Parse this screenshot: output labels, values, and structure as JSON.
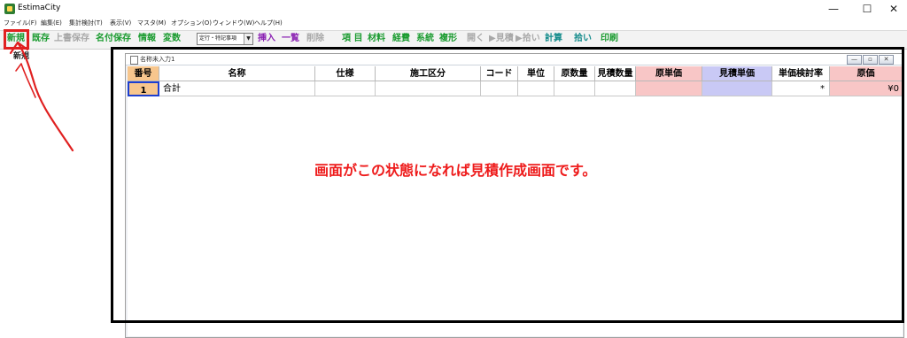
{
  "window": {
    "title": "EstimaCity",
    "controls": {
      "minimize": "—",
      "maximize": "☐",
      "close": "✕"
    }
  },
  "menu": [
    "ファイル(F)",
    "編集(E)",
    "集計検討(T)",
    "表示(V)",
    "マスタ(M)",
    "オプション(O)",
    "ウィンドウ(W)",
    "ヘルプ(H)"
  ],
  "toolbar": {
    "new": "新規",
    "existing": "既存",
    "overwrite_save": "上書保存",
    "save_as": "名付保存",
    "info": "情報",
    "variables": "変数",
    "combo_value": "定行・特記事項",
    "insert": "挿入",
    "list": "一覧",
    "delete": "削除",
    "item": "項 目",
    "material": "材料",
    "expense": "経費",
    "system": "系統",
    "composite": "複形",
    "open": "開く",
    "view_estimate": "▶見積",
    "pickup": "▶拾い",
    "calculate": "計算",
    "pickup2": "拾い",
    "print": "印刷"
  },
  "tree": {
    "root_label": "新規"
  },
  "child_window": {
    "title": "名称未入力1",
    "controls": {
      "minimize": "—",
      "restore": "▫",
      "close": "✕"
    }
  },
  "grid": {
    "columns": [
      "番号",
      "名称",
      "仕様",
      "施工区分",
      "コード",
      "単位",
      "原数量",
      "見積数量",
      "原単価",
      "見積単価",
      "単価検討率",
      "原価"
    ],
    "rows": [
      {
        "no": "1",
        "name": "合計",
        "spec": "",
        "division": "",
        "code": "",
        "unit": "",
        "orig_qty": "",
        "est_qty": "",
        "orig_unit_price": "",
        "est_unit_price": "",
        "rate": "*",
        "cost": "¥0"
      }
    ]
  },
  "annotation": {
    "text": "画面がこの状態になれば見積作成画面です。"
  },
  "colors": {
    "annotation_red": "#e02020",
    "header_orange": "#f7c68d",
    "pink_column": "#f8c6c6",
    "lavender_column": "#c9c9f5",
    "toolbar_green": "#1a9b2f"
  }
}
